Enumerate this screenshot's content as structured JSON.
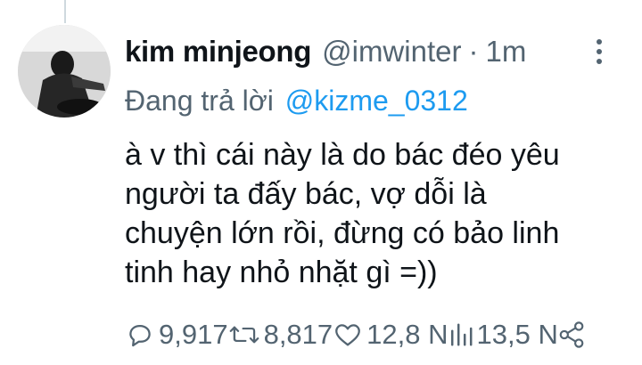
{
  "tweet": {
    "author_name": "kim minjeong",
    "author_handle": "@imwinter",
    "separator": "·",
    "timestamp": "1m",
    "reply_prefix": "Đang trả lời",
    "reply_to": "@kizme_0312",
    "text_lines": [
      "à v thì cái này là do bác đéo yêu",
      "người ta đấy bác, vợ dỗi là",
      "chuyện lớn rồi, đừng có bảo linh",
      "tinh hay nhỏ nhặt gì =))"
    ]
  },
  "actions": {
    "replies": "9,917",
    "retweets": "8,817",
    "likes": "12,8 N",
    "views": "13,5 N"
  },
  "icons": {
    "more": "more-vertical-icon",
    "reply": "reply-icon",
    "retweet": "retweet-icon",
    "like": "heart-icon",
    "views": "views-icon",
    "share": "share-icon"
  },
  "colors": {
    "text": "#0f1419",
    "muted": "#536471",
    "link": "#1d9bf0"
  }
}
